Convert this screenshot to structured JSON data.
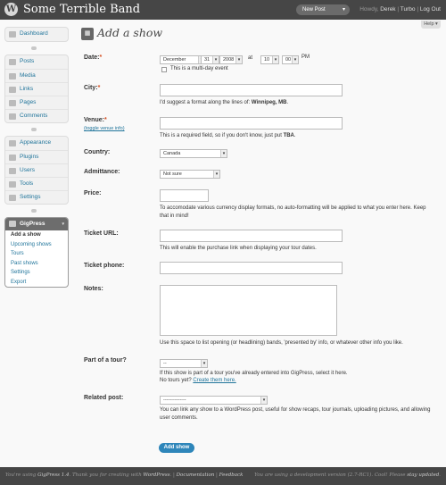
{
  "topbar": {
    "site_title": "Some Terrible Band",
    "logo": "W",
    "new_post_label": "New Post",
    "new_post_arrow": "▾",
    "howdy": "Howdy,",
    "user": "Derek",
    "sep1": "|",
    "turbo": "Turbo",
    "sep2": "|",
    "logout": "Log Out"
  },
  "help_tab": "Help ▾",
  "menu": {
    "dashboard": "Dashboard",
    "content": [
      "Posts",
      "Media",
      "Links",
      "Pages",
      "Comments"
    ],
    "settings": [
      "Appearance",
      "Plugins",
      "Users",
      "Tools",
      "Settings"
    ],
    "gigpress": {
      "title": "GigPress",
      "arrow": "▾",
      "items": [
        "Add a show",
        "Upcoming shows",
        "Tours",
        "Past shows",
        "Settings",
        "Export"
      ]
    }
  },
  "page": {
    "title": "Add a show"
  },
  "form": {
    "date": {
      "label": "Date:",
      "required": "*",
      "month": "December",
      "day": "31",
      "year": "2008",
      "at": "at",
      "hour": "10",
      "minute": "00",
      "ampm": "PM",
      "multiday": "This is a multi-day event"
    },
    "city": {
      "label": "City:",
      "required": "*",
      "help_prefix": "I'd suggest a format along the lines of: ",
      "help_example": "Winnipeg, MB",
      "help_suffix": "."
    },
    "venue": {
      "label": "Venue:",
      "required": "*",
      "toggle": "(toggle venue info)",
      "help_prefix": "This is a required field, so if you don't know, just put ",
      "help_example": "TBA",
      "help_suffix": "."
    },
    "country": {
      "label": "Country:",
      "value": "Canada"
    },
    "admittance": {
      "label": "Admittance:",
      "value": "Not sure"
    },
    "price": {
      "label": "Price:",
      "help": "To accomodate various currency display formats, no auto-formatting will be applied to what you enter here. Keep that in mind!"
    },
    "ticket_url": {
      "label": "Ticket URL:",
      "help": "This will enable the purchase link when displaying your tour dates."
    },
    "ticket_phone": {
      "label": "Ticket phone:"
    },
    "notes": {
      "label": "Notes:",
      "help": "Use this space to list opening (or headlining) bands, 'presented by' info, or whatever other info you like."
    },
    "tour": {
      "label": "Part of a tour?",
      "value": "--",
      "help": "If this show is part of a tour you've already entered into GigPress, select it here.",
      "help2_prefix": "No tours yet? ",
      "help2_link": "Create them here."
    },
    "related": {
      "label": "Related post:",
      "value": "--------------",
      "help": "You can link any show to a WordPress post, useful for show recaps, tour journals, uploading pictures, and allowing user comments."
    },
    "submit": "Add show"
  },
  "footer": {
    "thanks_prefix": "You're using ",
    "gigpress": "GigPress 1.4",
    "thanks_mid": ". Thank you for creating with ",
    "wordpress": "WordPress",
    "sep1": ". | ",
    "documentation": "Documentation",
    "sep2": " | ",
    "feedback": "Feedback",
    "dev_prefix": "You are using a development version (2.7-RC1). Cool! Please ",
    "stay_updated": "stay updated",
    "dev_suffix": "."
  }
}
